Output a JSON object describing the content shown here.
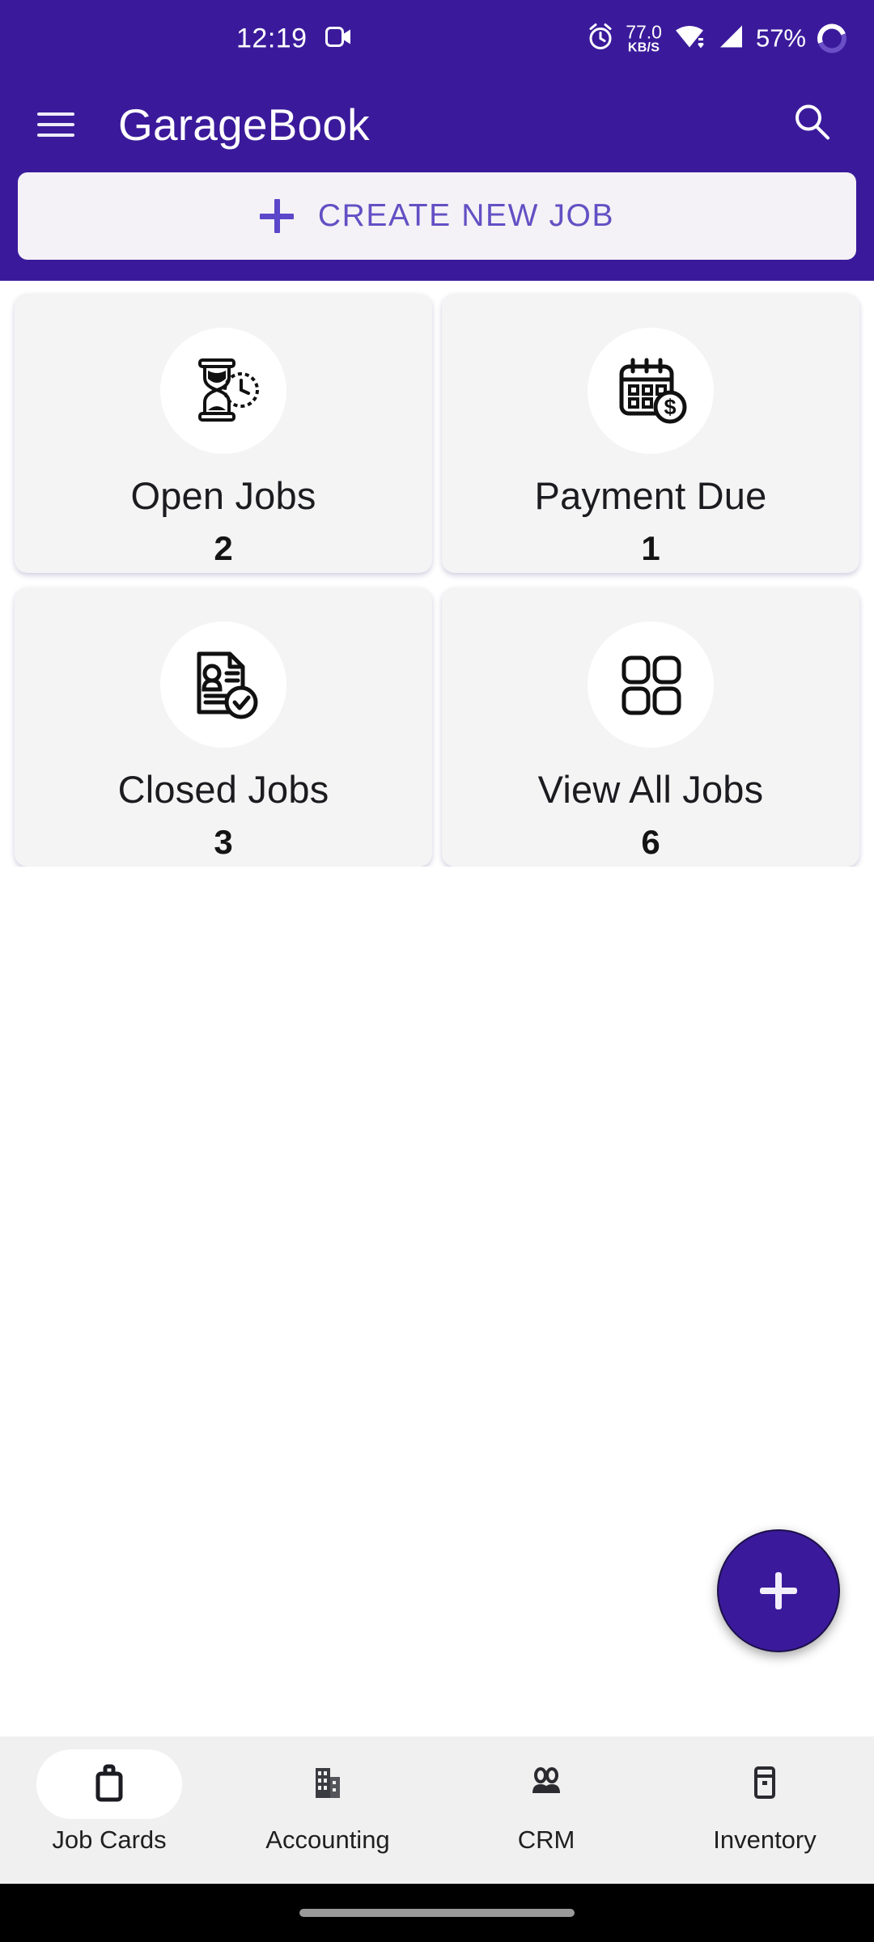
{
  "status_bar": {
    "time": "12:19",
    "video_icon": "video-camera-icon",
    "alarm_icon": "alarm-clock-icon",
    "network_speed_value": "77.0",
    "network_speed_unit": "KB/S",
    "wifi_icon": "wifi-icon",
    "signal_icon": "cellular-signal-icon",
    "battery_percent": "57%",
    "battery_ring_icon": "battery-ring-icon"
  },
  "app_bar": {
    "menu_icon": "hamburger-menu-icon",
    "title": "GarageBook",
    "search_icon": "search-icon"
  },
  "create_job": {
    "plus_icon": "plus-icon",
    "label": "CREATE NEW JOB"
  },
  "cards": [
    {
      "icon": "hourglass-clock-icon",
      "label": "Open Jobs",
      "count": "2"
    },
    {
      "icon": "calendar-dollar-icon",
      "label": "Payment Due",
      "count": "1"
    },
    {
      "icon": "document-person-check-icon",
      "label": "Closed Jobs",
      "count": "3"
    },
    {
      "icon": "grid-four-squares-icon",
      "label": "View All Jobs",
      "count": "6"
    }
  ],
  "fab": {
    "icon": "plus-icon",
    "label": "+"
  },
  "bottom_nav": {
    "items": [
      {
        "icon": "briefcase-icon",
        "label": "Job Cards",
        "active": true
      },
      {
        "icon": "building-icon",
        "label": "Accounting",
        "active": false
      },
      {
        "icon": "people-icon",
        "label": "CRM",
        "active": false
      },
      {
        "icon": "inventory-box-icon",
        "label": "Inventory",
        "active": false
      }
    ]
  },
  "colors": {
    "brand_purple": "#3A1A9B",
    "accent_purple": "#6250c4",
    "card_bg": "#f4f4f5",
    "nav_bg": "#f0f0f0"
  }
}
